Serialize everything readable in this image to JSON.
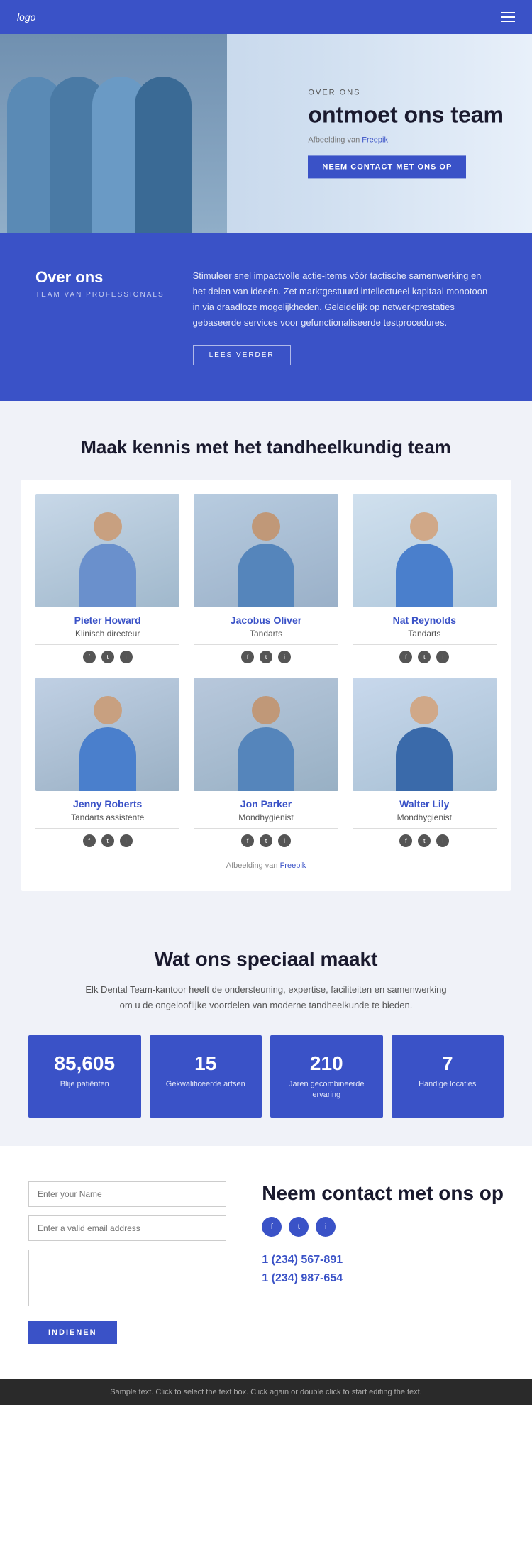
{
  "header": {
    "logo": "logo"
  },
  "hero": {
    "overline": "OVER ONS",
    "title": "ontmoet ons team",
    "caption": "Afbeelding van",
    "caption_link": "Freepik",
    "button_label": "NEEM CONTACT MET ONS OP"
  },
  "about": {
    "title": "Over ons",
    "subtitle": "TEAM VAN PROFESSIONALS",
    "text": "Stimuleer snel impactvolle actie-items vóór tactische samenwerking en het delen van ideeën. Zet marktgestuurd intellectueel kapitaal monotoon in via draadloze mogelijkheden. Geleidelijk op netwerkprestaties gebaseerde services voor gefunctionaliseerde testprocedures.",
    "button_label": "LEES VERDER"
  },
  "team": {
    "heading": "Maak kennis met het tandheelkundig team",
    "members": [
      {
        "name": "Pieter Howard",
        "role": "Klinisch directeur"
      },
      {
        "name": "Jacobus Oliver",
        "role": "Tandarts"
      },
      {
        "name": "Nat Reynolds",
        "role": "Tandarts"
      },
      {
        "name": "Jenny Roberts",
        "role": "Tandarts assistente"
      },
      {
        "name": "Jon Parker",
        "role": "Mondhygienist"
      },
      {
        "name": "Walter Lily",
        "role": "Mondhygienist"
      }
    ],
    "credit_prefix": "Afbeelding van",
    "credit_link": "Freepik"
  },
  "special": {
    "heading": "Wat ons speciaal maakt",
    "text": "Elk Dental Team-kantoor heeft de ondersteuning, expertise, faciliteiten en samenwerking om u de ongelooflijke voordelen van moderne tandheelkunde te bieden.",
    "stats": [
      {
        "number": "85,605",
        "label": "Blije patiënten"
      },
      {
        "number": "15",
        "label": "Gekwalificeerde artsen"
      },
      {
        "number": "210",
        "label": "Jaren gecombineerde ervaring"
      },
      {
        "number": "7",
        "label": "Handige locaties"
      }
    ]
  },
  "contact": {
    "form": {
      "name_placeholder": "Enter your Name",
      "email_placeholder": "Enter a valid email address",
      "message_placeholder": "",
      "submit_label": "INDIENEN"
    },
    "info": {
      "title": "Neem contact met ons op",
      "phones": [
        "1 (234) 567-891",
        "1 (234) 987-654"
      ]
    }
  },
  "footer": {
    "text": "Sample text. Click to select the text box. Click again or double click to start editing the text."
  }
}
